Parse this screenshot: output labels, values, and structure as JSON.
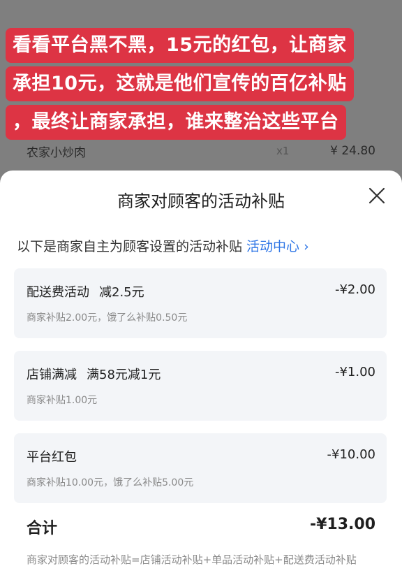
{
  "caption": {
    "lines": [
      "看看平台黑不黑，15元的红包，让商家",
      "承担10元，这就是他们宣传的百亿补贴",
      "，最终让商家承担，谁来整治这些平台"
    ]
  },
  "background_item": {
    "name": "农家小炒肉",
    "qty": "x1",
    "price": "¥ 24.80"
  },
  "sheet": {
    "title": "商家对顾客的活动补贴",
    "close_icon": "close-icon",
    "subtitle": "以下是商家自主为顾客设置的活动补贴 ",
    "subtitle_link": "活动中心 ›",
    "items": [
      {
        "name": "配送费活动",
        "rule": "减2.5元",
        "amount": "-¥2.00",
        "detail": "商家补贴2.00元，饿了么补贴0.50元"
      },
      {
        "name": "店铺满减",
        "rule": "满58元减1元",
        "amount": "-¥1.00",
        "detail": "商家补贴1.00元"
      },
      {
        "name": "平台红包",
        "rule": "",
        "amount": "-¥10.00",
        "detail": "商家补贴10.00元，饿了么补贴5.00元"
      }
    ],
    "total_label": "合计",
    "total_value": "-¥13.00",
    "formula": "商家对顾客的活动补贴=店铺活动补贴+单品活动补贴+配送费活动补贴"
  },
  "colors": {
    "caption_bg": "#dd3444",
    "link": "#2f76e6",
    "card_bg": "#f3f5f8"
  }
}
